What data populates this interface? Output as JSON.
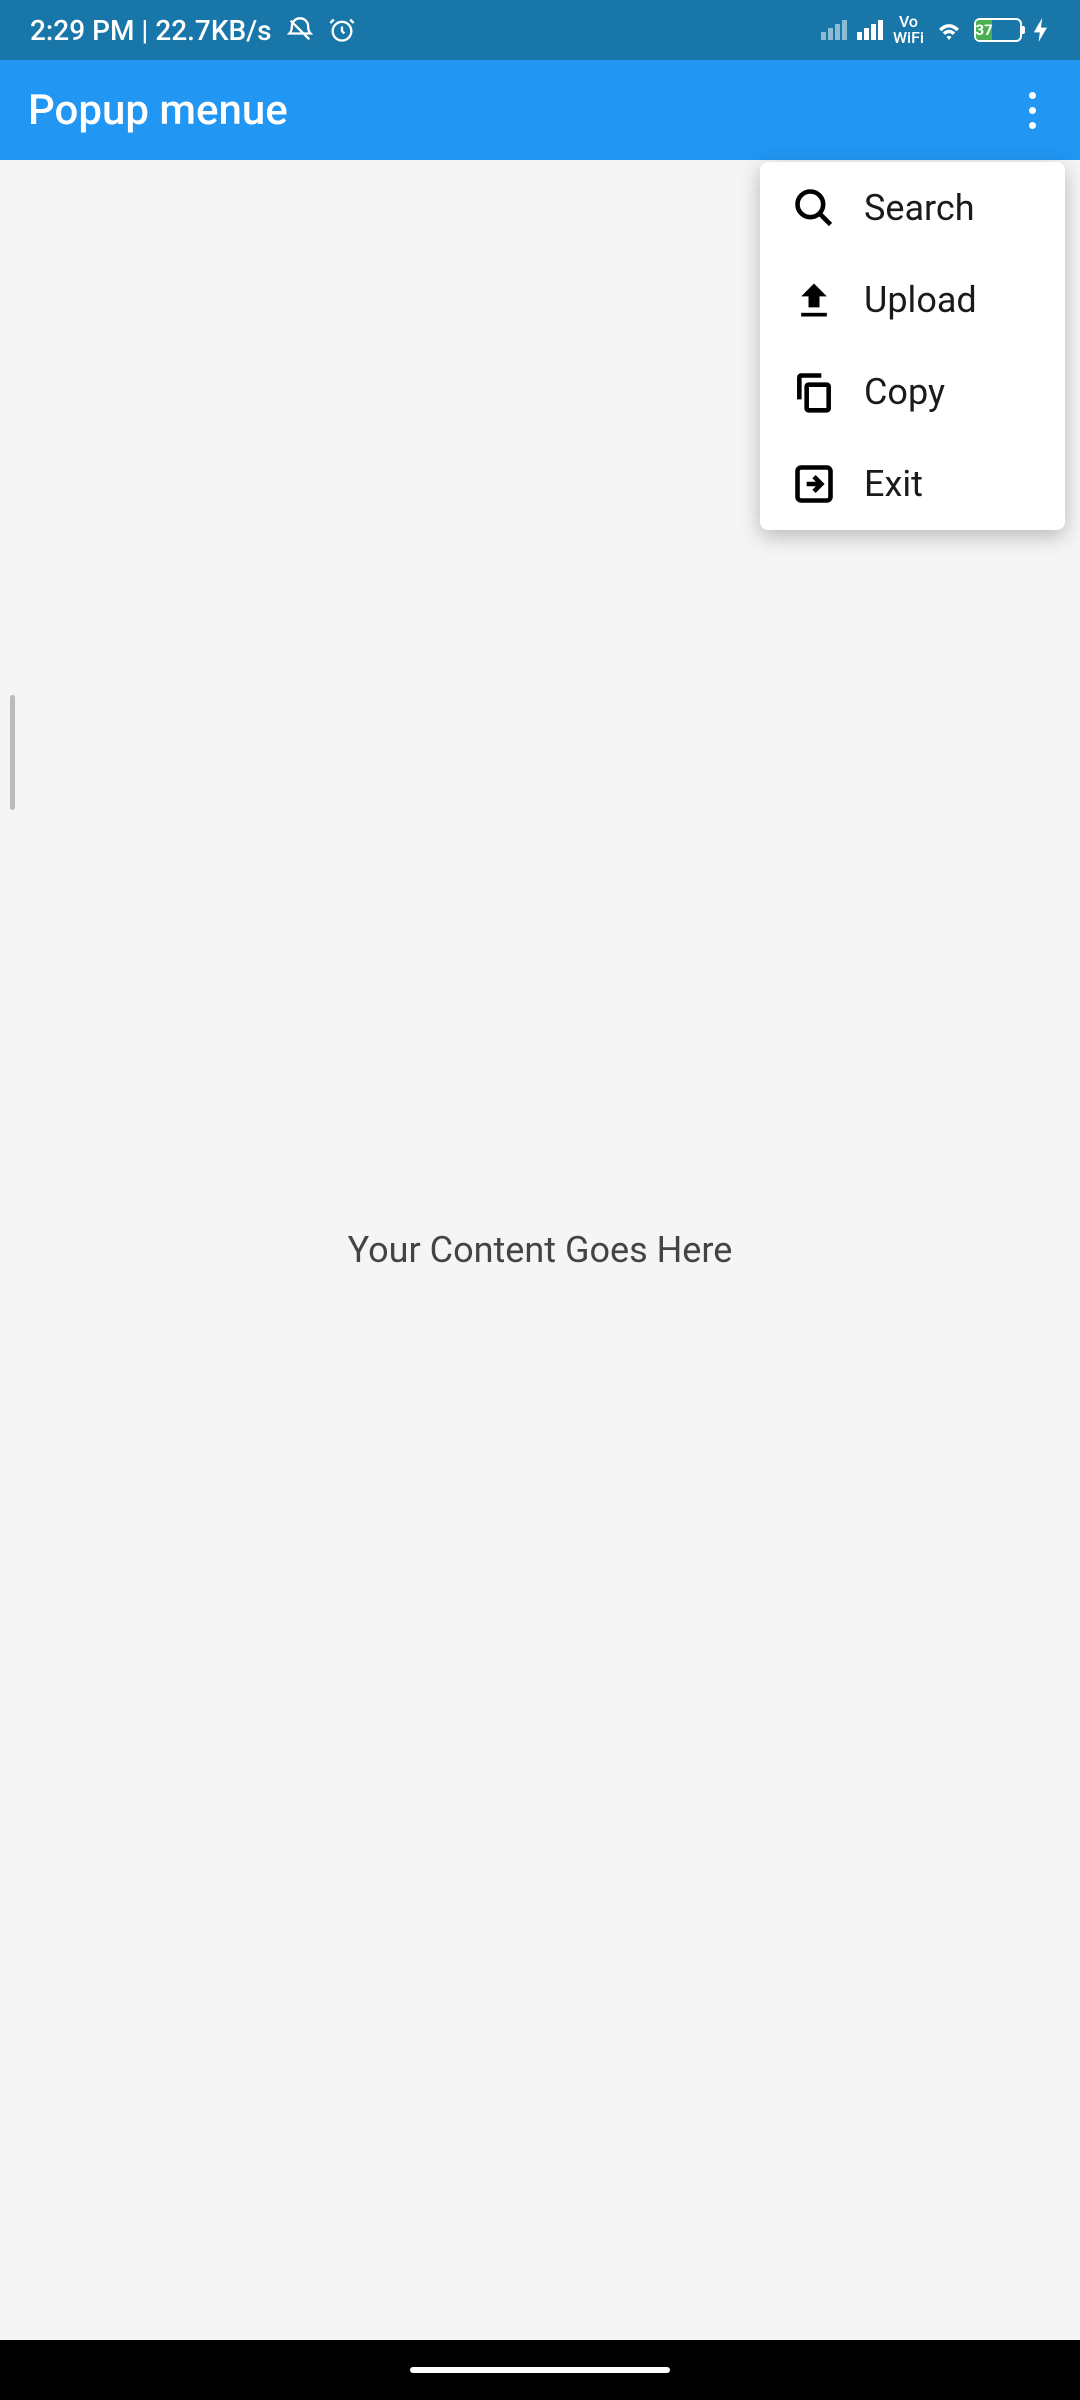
{
  "status_bar": {
    "time": "2:29 PM | 22.7KB/s",
    "battery_percent": "37",
    "wifi_label": "WiFi",
    "vo_label": "Vo"
  },
  "app_bar": {
    "title": "Popup menue"
  },
  "popup_menu": {
    "items": [
      {
        "icon": "search",
        "label": "Search"
      },
      {
        "icon": "upload",
        "label": "Upload"
      },
      {
        "icon": "copy",
        "label": "Copy"
      },
      {
        "icon": "exit",
        "label": "Exit"
      }
    ]
  },
  "content": {
    "placeholder": "Your Content Goes Here"
  }
}
